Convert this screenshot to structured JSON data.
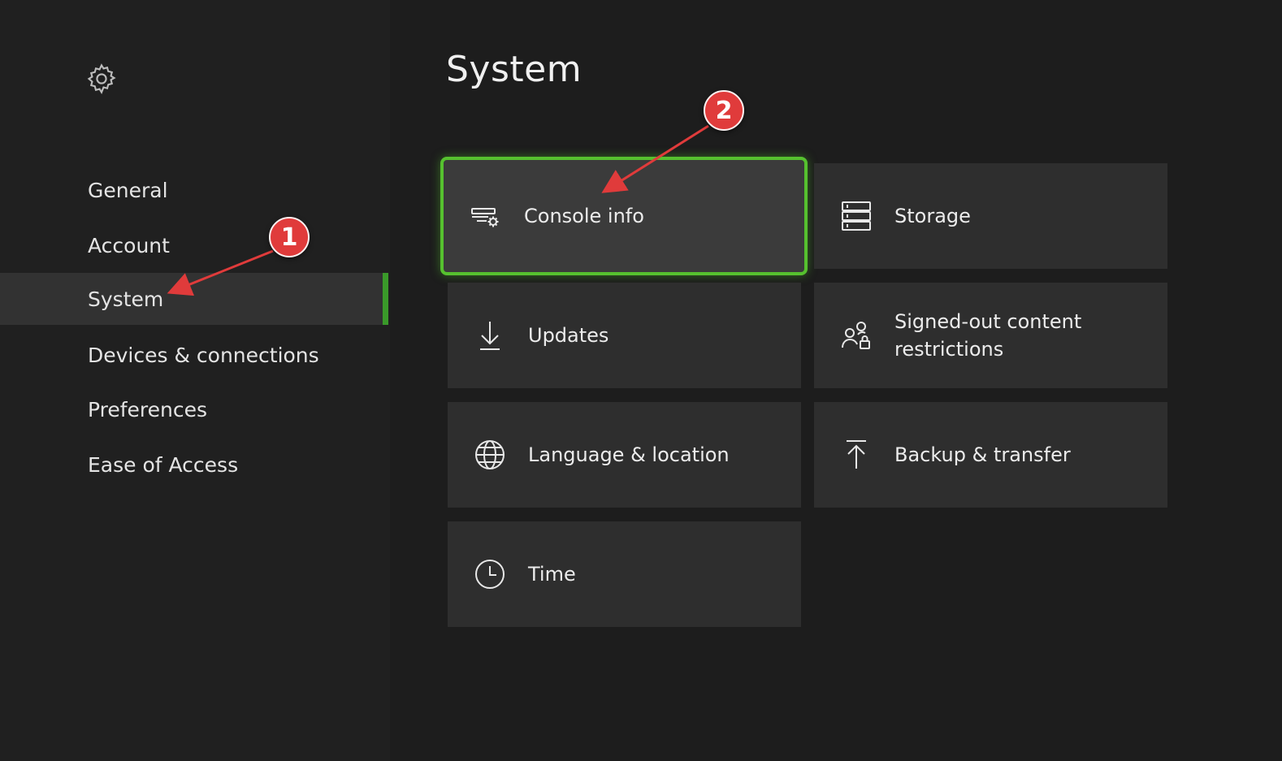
{
  "sidebar": {
    "icon": "gear-icon",
    "items": [
      {
        "label": "General"
      },
      {
        "label": "Account"
      },
      {
        "label": "System"
      },
      {
        "label": "Devices & connections"
      },
      {
        "label": "Preferences"
      },
      {
        "label": "Ease of Access"
      }
    ],
    "active_index": 2,
    "active_indicator_color": "#3a9a2a"
  },
  "main": {
    "title": "System",
    "tiles": [
      {
        "label": "Console info",
        "icon": "console-info-icon"
      },
      {
        "label": "Storage",
        "icon": "storage-icon"
      },
      {
        "label": "Updates",
        "icon": "download-icon"
      },
      {
        "label": "Signed-out content restrictions",
        "icon": "users-lock-icon"
      },
      {
        "label": "Language & location",
        "icon": "globe-icon"
      },
      {
        "label": "Backup & transfer",
        "icon": "upload-icon"
      },
      {
        "label": "Time",
        "icon": "clock-icon"
      }
    ],
    "focused_tile": "Console info",
    "focus_color": "#56c12f"
  },
  "annotations": [
    {
      "number": "1",
      "target": "System"
    },
    {
      "number": "2",
      "target": "Console info"
    }
  ],
  "annotation_color": "#e03b3b"
}
